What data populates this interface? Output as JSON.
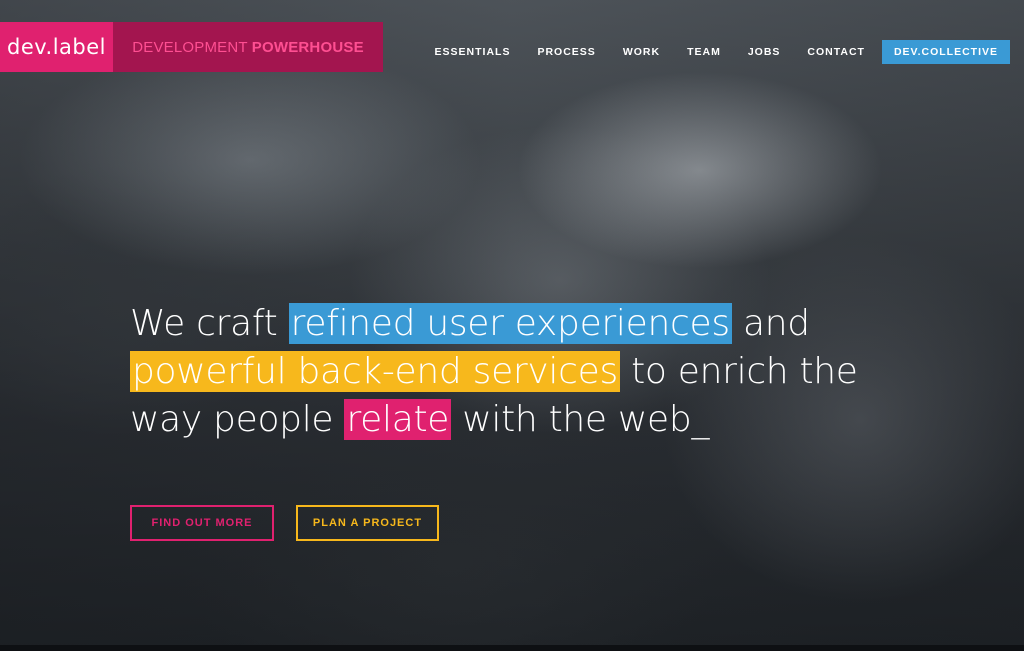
{
  "brand": {
    "logo": "dev.label",
    "tagline_light": "DEVELOPMENT",
    "tagline_bold": "POWERHOUSE"
  },
  "nav": {
    "items": [
      "ESSENTIALS",
      "PROCESS",
      "WORK",
      "TEAM",
      "JOBS",
      "CONTACT"
    ],
    "cta": "DEV.COLLECTIVE"
  },
  "hero": {
    "line1_a": "We craft ",
    "line1_hl": "refined user experiences",
    "line1_b": " and",
    "line2_hl": "powerful back-end services",
    "line2_b": " to enrich the",
    "line3_a": "way people ",
    "line3_hl": "relate",
    "line3_b": " with the web_"
  },
  "buttons": {
    "find_out_more": "FIND OUT MORE",
    "plan_project": "PLAN A PROJECT"
  },
  "colors": {
    "pink": "#e0216f",
    "pink_dark": "#a3154f",
    "blue": "#3a9ad5",
    "yellow": "#f7b81c"
  }
}
